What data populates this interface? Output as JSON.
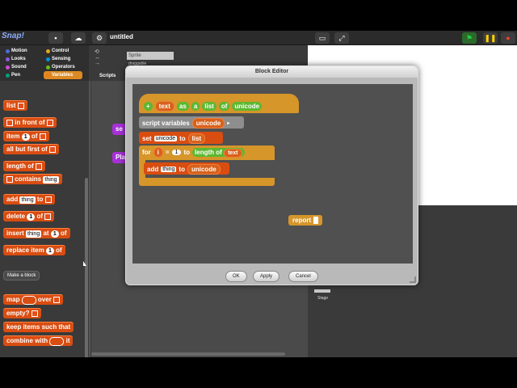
{
  "app": {
    "logo": "Snap!",
    "project_title": "untitled"
  },
  "categories": [
    {
      "label": "Motion",
      "color": "#4a6cd4"
    },
    {
      "label": "Control",
      "color": "#e1a91a"
    },
    {
      "label": "Looks",
      "color": "#8f56e3"
    },
    {
      "label": "Sensing",
      "color": "#0494dc"
    },
    {
      "label": "Sound",
      "color": "#cf4ad9"
    },
    {
      "label": "Operators",
      "color": "#62c213"
    },
    {
      "label": "Pen",
      "color": "#00a178"
    },
    {
      "label": "Variables",
      "color": "#ee7d16"
    }
  ],
  "selected_category": "Variables",
  "palette": {
    "list": "list",
    "in_front_of": "in front of",
    "item": "item",
    "item_num": "1",
    "of": "of",
    "all_but_first_of": "all but first of",
    "length_of": "length of",
    "contains": "contains",
    "thing": "thing",
    "add": "add",
    "to": "to",
    "delete": "delete",
    "insert": "insert",
    "at": "at",
    "replace_item": "replace item",
    "with": "with",
    "make_block": "Make a block",
    "map": "map",
    "over": "over",
    "empty": "empty?",
    "keep_items": "keep items such that",
    "combine_with": "combine with",
    "i_label": "it"
  },
  "scripts": {
    "sprite_name": "Sprite",
    "draggable": "draggable",
    "tab_label": "Scripts",
    "partial_block_1": "se",
    "partial_block_2": "Pla"
  },
  "stage": {
    "corral_label": "Stage"
  },
  "dialog": {
    "title": "Block Editor",
    "hat_words": [
      "+",
      "text",
      "text",
      "+",
      "as",
      "+",
      "a",
      "+",
      "list",
      "+",
      "of",
      "+",
      "unicode"
    ],
    "script_variables": "script variables",
    "var_unicode": "unicode",
    "set": "set",
    "set_to": "to",
    "list_block": "list",
    "for": "for",
    "for_i": "i",
    "eq": "=",
    "for_start": "1",
    "for_to": "to",
    "length_of": "length of",
    "text_var": "text",
    "add": "add",
    "thing": "thing",
    "add_to": "to",
    "report": "report",
    "ok": "OK",
    "apply": "Apply",
    "cancel": "Cancel"
  }
}
